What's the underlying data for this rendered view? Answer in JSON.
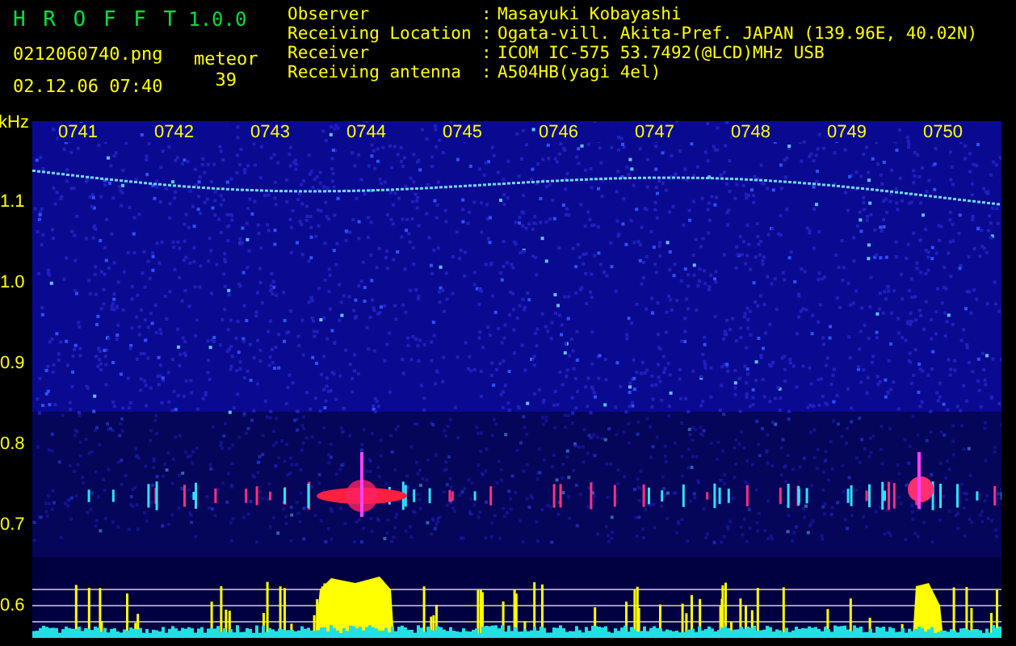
{
  "app": {
    "title": "H R O F F T",
    "version": "1.0.0",
    "filename": "0212060740.png",
    "datetime": "02.12.06 07:40",
    "count_label": "meteor",
    "count": "39"
  },
  "separator": ":",
  "info": [
    {
      "label": "Observer",
      "value": "Masayuki Kobayashi"
    },
    {
      "label": "Receiving Location",
      "value": "Ogata-vill. Akita-Pref. JAPAN (139.96E, 40.02N)"
    },
    {
      "label": "Receiver",
      "value": "ICOM IC-575 53.7492(@LCD)MHz USB"
    },
    {
      "label": "Receiving antenna",
      "value": "A504HB(yagi 4el)"
    }
  ],
  "spectrogram": {
    "unit": "kHz",
    "time_labels": [
      "0741",
      "0742",
      "0743",
      "0744",
      "0745",
      "0746",
      "0747",
      "0748",
      "0749",
      "0750"
    ],
    "freq_labels": [
      "1.1",
      "1.0",
      "0.9",
      "0.8",
      "0.7",
      "0.6"
    ]
  }
}
